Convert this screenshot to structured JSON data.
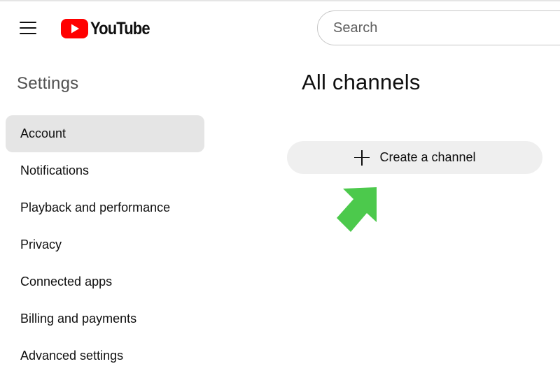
{
  "header": {
    "menu_icon": "hamburger-menu-icon",
    "logo_text": "YouTube",
    "search": {
      "placeholder": "Search",
      "value": ""
    }
  },
  "sidebar": {
    "title": "Settings",
    "items": [
      {
        "label": "Account",
        "active": true
      },
      {
        "label": "Notifications",
        "active": false
      },
      {
        "label": "Playback and performance",
        "active": false
      },
      {
        "label": "Privacy",
        "active": false
      },
      {
        "label": "Connected apps",
        "active": false
      },
      {
        "label": "Billing and payments",
        "active": false
      },
      {
        "label": "Advanced settings",
        "active": false
      }
    ]
  },
  "main": {
    "title": "All channels",
    "create_button": {
      "icon": "plus-icon",
      "label": "Create a channel"
    },
    "annotation_icon": "green-arrow-icon"
  },
  "colors": {
    "brand_red": "#ff0000",
    "active_nav_bg": "#e5e5e5",
    "button_bg": "#efefef",
    "annotation_green": "#4cc94c"
  }
}
